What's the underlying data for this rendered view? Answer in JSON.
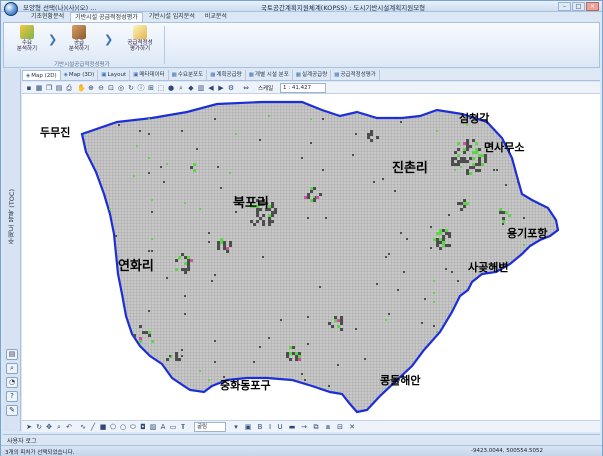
{
  "window": {
    "title": "국토공간계획지원체계(KOPSS) : 도시기반시설계획지원모형",
    "quick_access": "모양형 선택(나)(사)(오) ..."
  },
  "ribbon": {
    "tabs": [
      "기초현황분석",
      "기반시설 공급적정성평가",
      "기반시설 입지분석",
      "비교분석"
    ],
    "active_tab": 1,
    "buttons": [
      {
        "label": "수요\n분석하기",
        "icon": "demand-analysis-icon"
      },
      {
        "label": "공급\n분석하기",
        "icon": "supply-analysis-icon"
      },
      {
        "label": "공급적정성\n평가하기",
        "icon": "adequacy-eval-icon"
      }
    ],
    "group_label": "기반시설공급적정성평가"
  },
  "left_dock": {
    "toc_label": "주제도 목록 (TOC)"
  },
  "doc_tabs": [
    {
      "label": "Map (2D)",
      "active": true
    },
    {
      "label": "Map (3D)",
      "active": false
    },
    {
      "label": "Layout",
      "active": false
    },
    {
      "label": "메타데이터",
      "active": false
    },
    {
      "label": "수요분포도",
      "active": false
    },
    {
      "label": "계획공급량",
      "active": false
    },
    {
      "label": "개별 시설 분포",
      "active": false
    },
    {
      "label": "실계공급량",
      "active": false
    },
    {
      "label": "공급적정성평가",
      "active": false
    }
  ],
  "map_toolbar": {
    "scale_label": "스케일",
    "scale_value": "1 : 41,427"
  },
  "map": {
    "colors": {
      "land": "#c5c5c5",
      "grid": "#9a9a9a",
      "coast": "#1c2fd6",
      "settlement": "#4d4d4d",
      "green": "#5fd64a",
      "pink": "#d04fa0"
    },
    "places": [
      {
        "label": "두무진"
      },
      {
        "label": "심청각"
      },
      {
        "label": "면사무소"
      },
      {
        "label": "진촌리"
      },
      {
        "label": "북포리"
      },
      {
        "label": "용기포항"
      },
      {
        "label": "연화리"
      },
      {
        "label": "사곶해변"
      },
      {
        "label": "콩돌해안"
      },
      {
        "label": "중화동포구"
      }
    ]
  },
  "draw_toolbar": {
    "font_name": "굴림"
  },
  "bottom_pane": {
    "tab_label": "사용자 로그"
  },
  "status": {
    "message": "3개의 피처가 선택되었습니다.",
    "coords": "-9423.0044, 500554.5052"
  }
}
